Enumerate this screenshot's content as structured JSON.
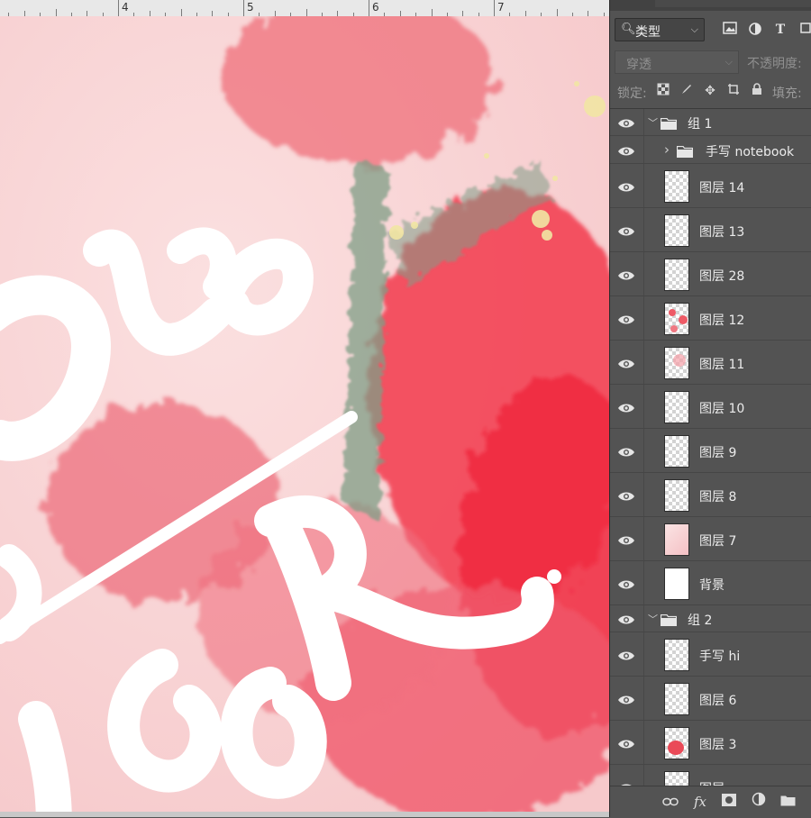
{
  "ruler": {
    "numbers": [
      "4",
      "5",
      "6",
      "7"
    ]
  },
  "canvas": {
    "artwork_text": "ote Book"
  },
  "layers_panel": {
    "filter": {
      "kind_label": "类型",
      "icons": [
        "image-filter-icon",
        "adjustment-filter-icon",
        "type-filter-icon",
        "shape-filter-icon"
      ]
    },
    "blend_mode": "穿透",
    "opacity_label": "不透明度:",
    "lock_label": "锁定:",
    "fill_label": "填充:",
    "layers": [
      {
        "name": "组 1",
        "kind": "group",
        "expanded": true,
        "depth": 0
      },
      {
        "name": "手写 notebook",
        "kind": "group",
        "expanded": false,
        "depth": 1
      },
      {
        "name": "图层 14",
        "kind": "layer",
        "thumb": "empty",
        "depth": 1
      },
      {
        "name": "图层 13",
        "kind": "layer",
        "thumb": "empty",
        "depth": 1
      },
      {
        "name": "图层 28",
        "kind": "layer",
        "thumb": "empty",
        "depth": 1
      },
      {
        "name": "图层 12",
        "kind": "layer",
        "thumb": "red-spots",
        "depth": 1
      },
      {
        "name": "图层 11",
        "kind": "layer",
        "thumb": "faint-red",
        "depth": 1
      },
      {
        "name": "图层 10",
        "kind": "layer",
        "thumb": "empty",
        "depth": 1
      },
      {
        "name": "图层 9",
        "kind": "layer",
        "thumb": "empty",
        "depth": 1
      },
      {
        "name": "图层 8",
        "kind": "layer",
        "thumb": "empty",
        "depth": 1
      },
      {
        "name": "图层 7",
        "kind": "layer",
        "thumb": "pink",
        "depth": 1
      },
      {
        "name": "背景",
        "kind": "layer",
        "thumb": "white",
        "depth": 1
      },
      {
        "name": "组 2",
        "kind": "group",
        "expanded": true,
        "depth": 0
      },
      {
        "name": "手写 hi",
        "kind": "layer",
        "thumb": "empty",
        "depth": 1
      },
      {
        "name": "图层 6",
        "kind": "layer",
        "thumb": "empty",
        "depth": 1
      },
      {
        "name": "图层 3",
        "kind": "layer",
        "thumb": "red-blob",
        "depth": 1
      },
      {
        "name": "图层",
        "kind": "layer",
        "thumb": "empty",
        "depth": 1
      }
    ],
    "footer_icons": [
      "link-layers-icon",
      "fx-icon",
      "add-mask-icon",
      "new-adjustment-icon",
      "new-group-icon"
    ],
    "footer_fx_label": "fx"
  }
}
